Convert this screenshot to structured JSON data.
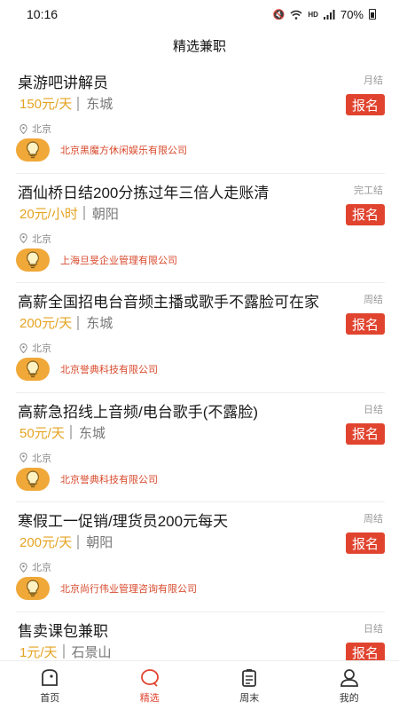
{
  "status_bar": {
    "time": "10:16",
    "hd": "HD",
    "battery": "70%"
  },
  "header": {
    "title": "精选兼职"
  },
  "colors": {
    "accent": "#e0442f",
    "pay": "#e5a321",
    "avatar": "#f0a838"
  },
  "jobs": [
    {
      "title": "桌游吧讲解员",
      "settle": "月结",
      "pay": "150元/天",
      "district": "东城",
      "location": "北京",
      "company": "北京黑魔方休闲娱乐有限公司",
      "apply": "报名"
    },
    {
      "title": "酒仙桥日结200分拣过年三倍人走账清",
      "settle": "完工结",
      "pay": "20元/小时",
      "district": "朝阳",
      "location": "北京",
      "company": "上海旦旻企业管理有限公司",
      "apply": "报名"
    },
    {
      "title": "高薪全国招电台音频主播或歌手不露脸可在家",
      "settle": "周结",
      "pay": "200元/天",
      "district": "东城",
      "location": "北京",
      "company": "北京誉典科技有限公司",
      "apply": "报名"
    },
    {
      "title": "高薪急招线上音频/电台歌手(不露脸)",
      "settle": "日结",
      "pay": "50元/天",
      "district": "东城",
      "location": "北京",
      "company": "北京誉典科技有限公司",
      "apply": "报名"
    },
    {
      "title": "寒假工一促销/理货员200元每天",
      "settle": "周结",
      "pay": "200元/天",
      "district": "朝阳",
      "location": "北京",
      "company": "北京尚行伟业管理咨询有限公司",
      "apply": "报名"
    },
    {
      "title": "售卖课包兼职",
      "settle": "日结",
      "pay": "1元/天",
      "district": "石景山",
      "location": "",
      "company": "",
      "apply": "报名"
    }
  ],
  "tabs": [
    {
      "label": "首页",
      "icon": "home-icon"
    },
    {
      "label": "精选",
      "icon": "featured-icon"
    },
    {
      "label": "周末",
      "icon": "weekend-icon"
    },
    {
      "label": "我的",
      "icon": "profile-icon"
    }
  ]
}
